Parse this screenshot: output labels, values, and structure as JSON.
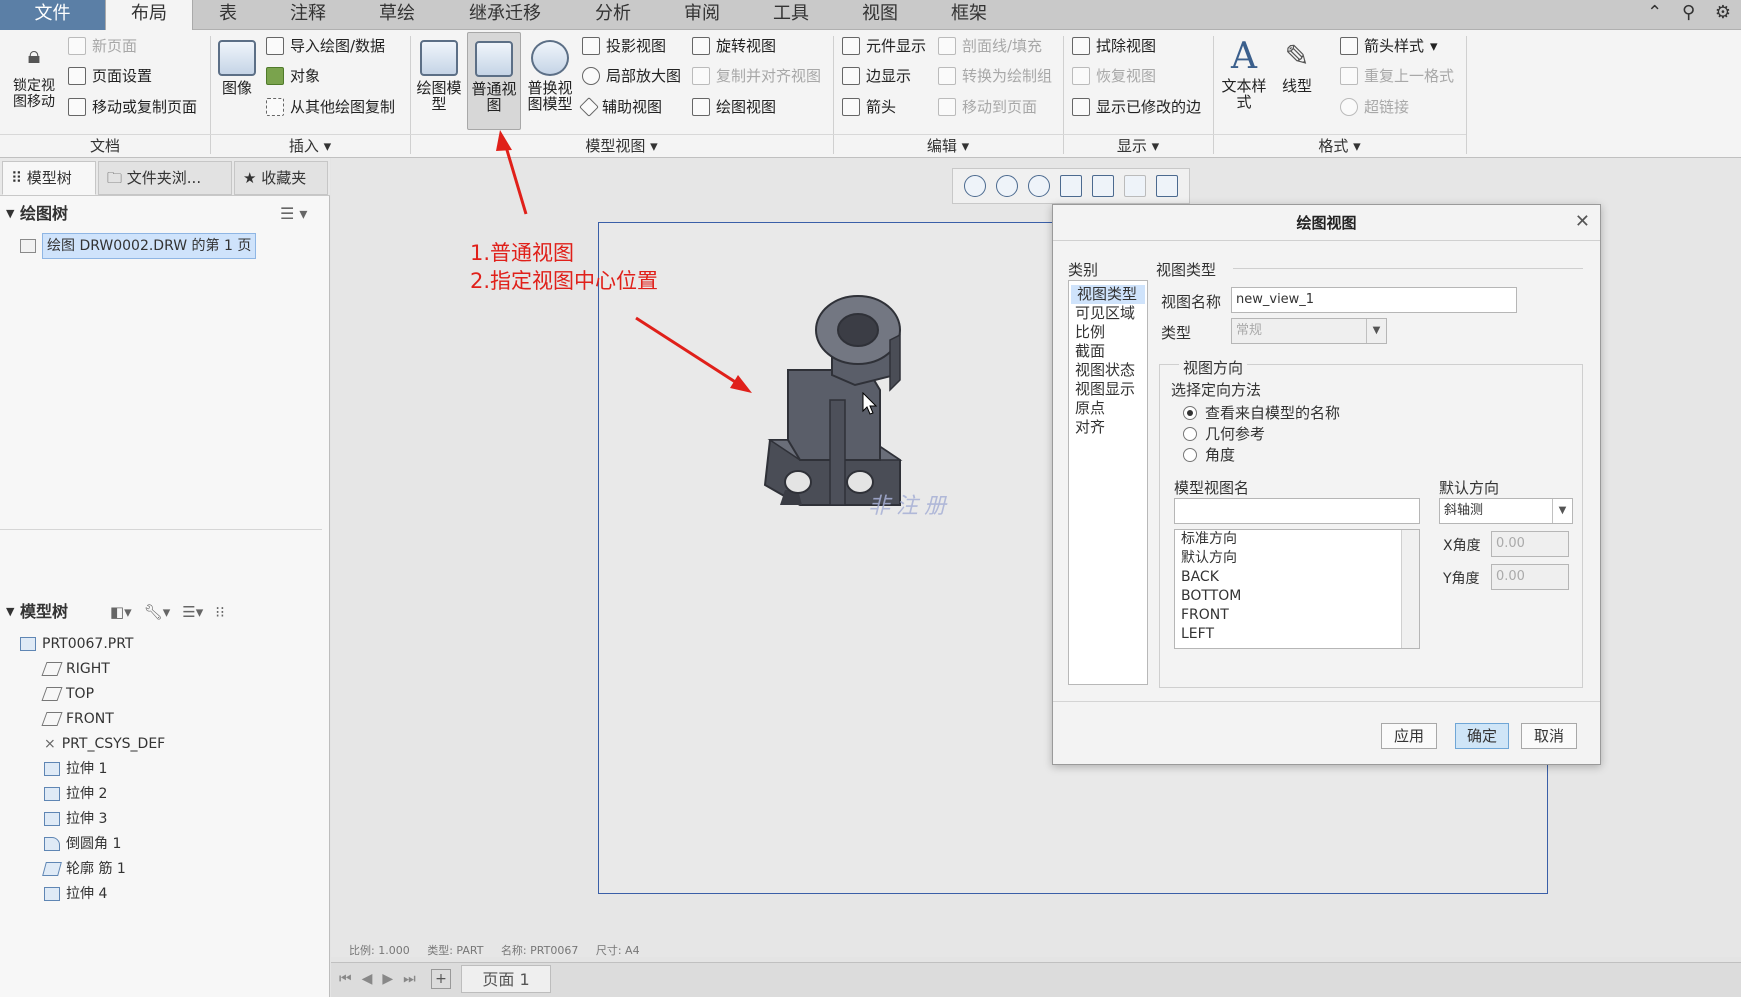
{
  "tabs": [
    "文件",
    "布局",
    "表",
    "注释",
    "草绘",
    "继承迁移",
    "分析",
    "审阅",
    "工具",
    "视图",
    "框架"
  ],
  "active_tab": "布局",
  "ribbon": {
    "document": {
      "lock_label": "锁定视\n图移动",
      "new_page": "新页面",
      "page_setup": "页面设置",
      "move_copy_page": "移动或复制页面",
      "group": "文档"
    },
    "insert": {
      "image": "图像",
      "import_drawing": "导入绘图/数据",
      "object": "对象",
      "copy_from_other": "从其他绘图复制",
      "group": "插入"
    },
    "model_views": {
      "drawing_model": "绘图模\n型",
      "general_view": "普通视\n图",
      "replace_model": "普换视\n图模型",
      "projection_view": "投影视图",
      "detailed_view": "局部放大图",
      "auxiliary_view": "辅助视图",
      "revolved_view": "旋转视图",
      "copy_align_view": "复制并对齐视图",
      "drawing_view": "绘图视图",
      "group": "模型视图"
    },
    "edit": {
      "component_display": "元件显示",
      "section_fill": "剖面线/填充",
      "edge_display": "边显示",
      "convert_to_draw_group": "转换为绘制组",
      "arrow": "箭头",
      "move_to_page": "移动到页面",
      "group": "编辑"
    },
    "display": {
      "erase_view": "拭除视图",
      "resume_view": "恢复视图",
      "show_modified_edges": "显示已修改的边",
      "group": "显示"
    },
    "format": {
      "text_style": "文本样\n式",
      "line_style": "线型",
      "arrow_style": "箭头样式",
      "repeat_last_format": "重复上一格式",
      "hyperlink": "超链接",
      "group": "格式"
    }
  },
  "left_panel": {
    "tabs": [
      "模型树",
      "文件夹浏...",
      "收藏夹"
    ],
    "drawing_tree_title": "绘图树",
    "drawing_tree_item": "绘图 DRW0002.DRW 的第 1 页",
    "model_tree_title": "模型树",
    "model_tree_items": [
      "PRT0067.PRT",
      "RIGHT",
      "TOP",
      "FRONT",
      "PRT_CSYS_DEF",
      "拉伸 1",
      "拉伸 2",
      "拉伸 3",
      "倒圆角 1",
      "轮廓 筋 1",
      "拉伸 4"
    ]
  },
  "annotation": {
    "line1": "1.普通视图",
    "line2": "2.指定视图中心位置",
    "color": "#e0201a"
  },
  "watermark": "非注册",
  "status": {
    "scale": "比例: 1.000",
    "type": "类型: PART",
    "name": "名称: PRT0067",
    "size": "尺寸: A4"
  },
  "page_tab": "页面 1",
  "dialog": {
    "title": "绘图视图",
    "category_label": "类别",
    "categories": [
      "视图类型",
      "可见区域",
      "比例",
      "截面",
      "视图状态",
      "视图显示",
      "原点",
      "对齐"
    ],
    "selected_category": "视图类型",
    "section_label": "视图类型",
    "view_name_label": "视图名称",
    "view_name_value": "new_view_1",
    "type_label": "类型",
    "type_value": "常规",
    "orientation_group": "视图方向",
    "orientation_method_label": "选择定向方法",
    "orientation_options": [
      "查看来自模型的名称",
      "几何参考",
      "角度"
    ],
    "orientation_selected": "查看来自模型的名称",
    "model_view_name_label": "模型视图名",
    "model_view_name_value": "",
    "model_views": [
      "标准方向",
      "默认方向",
      "BACK",
      "BOTTOM",
      "FRONT",
      "LEFT"
    ],
    "default_orientation_label": "默认方向",
    "default_orientation_value": "斜轴测",
    "x_angle_label": "X角度",
    "x_angle_value": "0.00",
    "y_angle_label": "Y角度",
    "y_angle_value": "0.00",
    "apply": "应用",
    "ok": "确定",
    "cancel": "取消"
  }
}
